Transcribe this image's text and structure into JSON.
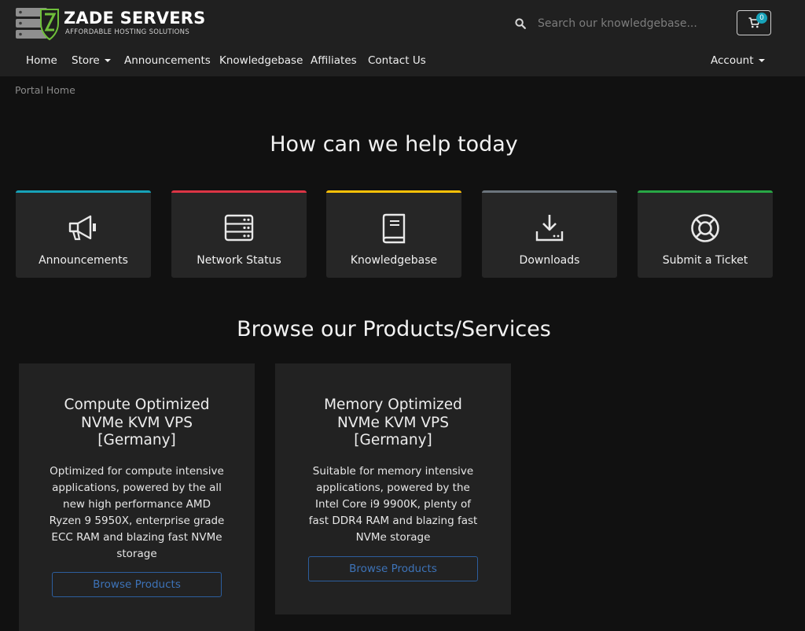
{
  "brand": {
    "name": "ZADE SERVERS",
    "tagline": "AFFORDABLE HOSTING SOLUTIONS",
    "logo_icon": "server-stack-shield-logo"
  },
  "search": {
    "placeholder": "Search our knowledgebase..."
  },
  "cart": {
    "count": "0",
    "icon": "shopping-cart-icon"
  },
  "nav": {
    "home": "Home",
    "store": "Store",
    "announcements": "Announcements",
    "knowledgebase": "Knowledgebase",
    "affiliates": "Affiliates",
    "contact_us": "Contact Us",
    "account": "Account"
  },
  "breadcrumb": "Portal Home",
  "help": {
    "heading": "How can we help today",
    "tiles": [
      {
        "label": "Announcements",
        "icon": "megaphone-icon",
        "accent": "#17a2b8"
      },
      {
        "label": "Network Status",
        "icon": "server-icon",
        "accent": "#dc3545"
      },
      {
        "label": "Knowledgebase",
        "icon": "book-icon",
        "accent": "#ffc107"
      },
      {
        "label": "Downloads",
        "icon": "download-icon",
        "accent": "#6c757d"
      },
      {
        "label": "Submit a Ticket",
        "icon": "life-ring-icon",
        "accent": "#28a745"
      }
    ]
  },
  "products": {
    "heading": "Browse our Products/Services",
    "items": [
      {
        "title": "Compute Optimized NVMe KVM VPS [Germany]",
        "description": "Optimized for compute intensive applications, powered by the all new high performance AMD Ryzen 9 5950X, enterprise grade ECC RAM and blazing fast NVMe storage",
        "button": "Browse Products"
      },
      {
        "title": "Memory Optimized NVMe KVM VPS [Germany]",
        "description": "Suitable for memory intensive applications, powered by the Intel Core i9 9900K, plenty of fast DDR4 RAM and blazing fast NVMe storage",
        "button": "Browse Products"
      }
    ]
  },
  "colors": {
    "page_bg": "#111111",
    "header_bg": "#202020",
    "tile_bg": "#262626",
    "card_bg": "#222222",
    "button_outline": "#2c5e9e",
    "badge": "#17a2b8"
  }
}
